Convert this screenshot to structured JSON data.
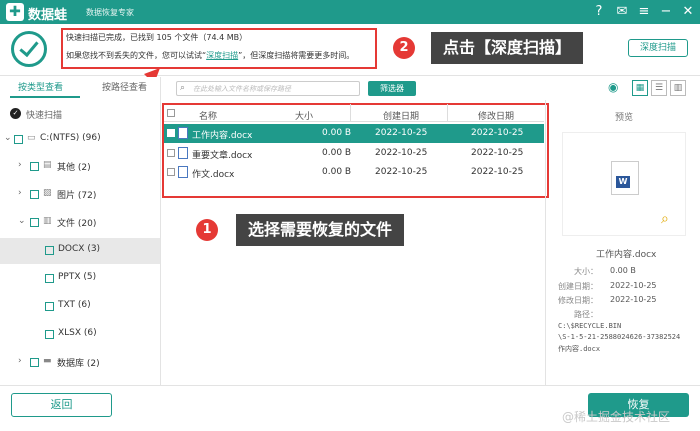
{
  "app": {
    "name": "数据蛙",
    "subtitle": "数据恢复专家"
  },
  "titlebar_icons": [
    "help-icon",
    "feedback-icon",
    "menu-icon",
    "minimize-icon",
    "close-icon"
  ],
  "info": {
    "line1": "快速扫描已完成，已找到 105 个文件（74.4 MB）",
    "line2_pre": "如果您找不到丢失的文件，您可以试试“",
    "deep_link": "深度扫描",
    "line2_post": "”，但深度扫描将需要更多时间。",
    "deep_button": "深度扫描"
  },
  "callouts": {
    "step2_num": "2",
    "step2_text": "点击【深度扫描】",
    "step1_num": "1",
    "step1_text": "选择需要恢复的文件"
  },
  "sidebar": {
    "tab_type": "按类型查看",
    "tab_path": "按路径查看",
    "quick_scan": "快速扫描",
    "tree": [
      {
        "label": "C:(NTFS) (96)"
      },
      {
        "label": "其他 (2)"
      },
      {
        "label": "图片 (72)"
      },
      {
        "label": "文件 (20)"
      },
      {
        "label": "DOCX (3)"
      },
      {
        "label": "PPTX (5)"
      },
      {
        "label": "TXT (6)"
      },
      {
        "label": "XLSX (6)"
      },
      {
        "label": "数据库 (2)"
      }
    ]
  },
  "toolbar": {
    "search_placeholder": "在此处输入文件名称或保存路径",
    "filter": "筛选器"
  },
  "table": {
    "headers": {
      "name": "名称",
      "size": "大小",
      "created": "创建日期",
      "modified": "修改日期"
    },
    "rows": [
      {
        "name": "工作内容.docx",
        "size": "0.00  B",
        "created": "2022-10-25",
        "modified": "2022-10-25"
      },
      {
        "name": "重要文章.docx",
        "size": "0.00  B",
        "created": "2022-10-25",
        "modified": "2022-10-25"
      },
      {
        "name": "作文.docx",
        "size": "0.00  B",
        "created": "2022-10-25",
        "modified": "2022-10-25"
      }
    ]
  },
  "preview": {
    "title": "预览",
    "filename": "工作内容.docx",
    "size_label": "大小：",
    "size": "0.00  B",
    "created_label": "创建日期：",
    "created": "2022-10-25",
    "modified_label": "修改日期：",
    "modified": "2022-10-25",
    "path_label": "路径：",
    "path_l1": "C:\\$RECYCLE.BIN",
    "path_l2": "\\S-1-5-21-2588024626-37382524",
    "path_l3": "作内容.docx"
  },
  "footer": {
    "back": "返回",
    "recover": "恢复"
  },
  "watermark": "@稀土掘金技术社区",
  "colors": {
    "accent": "#1f9a8b",
    "highlight": "#e53935",
    "callout_bg": "#444444"
  }
}
